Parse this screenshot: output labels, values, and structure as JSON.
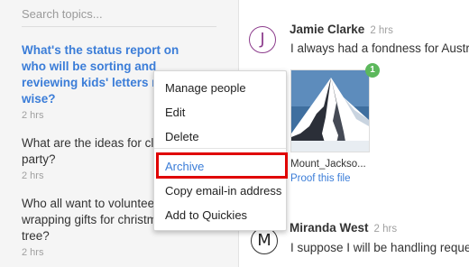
{
  "search": {
    "placeholder": "Search topics..."
  },
  "topics": [
    {
      "title": "What's the status report on who will be sorting and reviewing kids' letters more wise?",
      "time": "2 hrs",
      "active": true
    },
    {
      "title": "What are the ideas for cl... party?",
      "time": "2 hrs"
    },
    {
      "title": "Who all want to voluntee... wrapping gifts for christm... tree?",
      "time": "2 hrs"
    }
  ],
  "topic_lines": [
    [
      "What's the status report on",
      "who will be sorting and",
      "reviewing kids' letters m",
      "wise?"
    ],
    [
      "What are the ideas for cl",
      "party?"
    ],
    [
      "Who all want to voluntee",
      "wrapping gifts for christm",
      "tree?"
    ]
  ],
  "messages": [
    {
      "avatar": "J",
      "author": "Jamie Clarke",
      "time": "2 hrs",
      "text": "I always had a fondness for Austr",
      "attachment": {
        "badge": "1",
        "filename": "Mount_Jackso...",
        "action": "Proof this file"
      }
    },
    {
      "avatar": "M",
      "author": "Miranda West",
      "time": "2 hrs",
      "text": "I suppose I will be handling reque"
    }
  ],
  "context_menu": {
    "items": [
      "Manage people",
      "Edit",
      "Delete",
      "Archive",
      "Copy email-in address",
      "Add to Quickies"
    ],
    "highlighted": "Archive"
  },
  "colors": {
    "accent": "#3b7dd8",
    "highlight_box": "#e00000",
    "badge": "#5cb85c"
  }
}
